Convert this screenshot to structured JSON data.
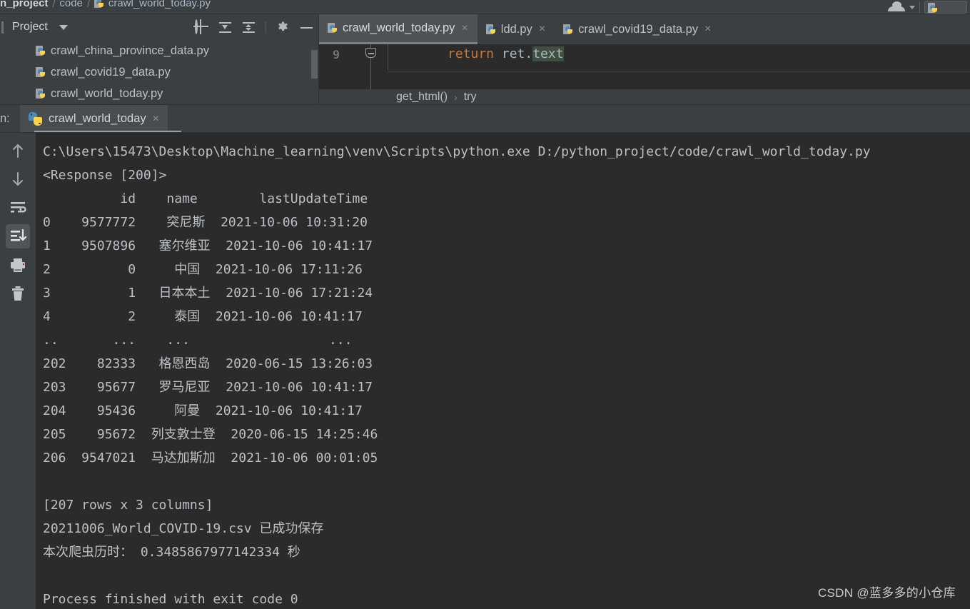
{
  "breadcrumb": {
    "project": "n_project",
    "sep": "/",
    "folder": "code",
    "file": "crawl_world_today.py"
  },
  "project_panel": {
    "title": "Project",
    "title_caret_icon": "chevron-down-icon",
    "tools": [
      {
        "name": "locate-icon",
        "label": "Select Opened File"
      },
      {
        "name": "expand-all-icon",
        "label": "Expand All"
      },
      {
        "name": "collapse-all-icon",
        "label": "Collapse All"
      },
      {
        "name": "gear-icon",
        "label": "Settings"
      },
      {
        "name": "minimize-icon",
        "label": "Hide"
      }
    ],
    "tree": [
      {
        "icon": "python-file-icon",
        "label": "crawl_china_province_data.py"
      },
      {
        "icon": "python-file-icon",
        "label": "crawl_covid19_data.py"
      },
      {
        "icon": "python-file-icon",
        "label": "crawl_world_today.py"
      }
    ]
  },
  "editor": {
    "tabs": [
      {
        "label": "crawl_world_today.py",
        "icon": "python-file-icon",
        "close": "×",
        "active": true
      },
      {
        "label": "ldd.py",
        "icon": "python-file-icon",
        "close": "×",
        "active": false
      },
      {
        "label": "crawl_covid19_data.py",
        "icon": "python-file-icon",
        "close": "×",
        "active": false
      }
    ],
    "line_number": "9",
    "code": {
      "keyword": "return",
      "expr_obj": " ret.",
      "expr_attr": "text"
    },
    "navbar": {
      "function": "get_html()",
      "sep": "›",
      "block": "try"
    }
  },
  "run_panel": {
    "label": "n:",
    "tab_label": "crawl_world_today",
    "tab_close": "×",
    "tab_icon": "python-logo-icon",
    "sidebar": [
      {
        "name": "up-arrow-icon",
        "label": "Previous Occurrence",
        "selected": false
      },
      {
        "name": "down-arrow-icon",
        "label": "Next Occurrence",
        "selected": false
      },
      {
        "name": "soft-wrap-icon",
        "label": "Soft-Wrap",
        "selected": false
      },
      {
        "name": "scroll-to-end-icon",
        "label": "Scroll to End",
        "selected": true
      },
      {
        "name": "printer-icon",
        "label": "Print",
        "selected": false
      },
      {
        "name": "trash-icon",
        "label": "Clear All",
        "selected": false
      }
    ]
  },
  "console": {
    "lines": [
      "C:\\Users\\15473\\Desktop\\Machine_learning\\venv\\Scripts\\python.exe D:/python_project/code/crawl_world_today.py",
      "<Response [200]>",
      "          id    name        lastUpdateTime",
      "0    9577772    突尼斯  2021-10-06 10:31:20",
      "1    9507896   塞尔维亚  2021-10-06 10:41:17",
      "2          0     中国  2021-10-06 17:11:26",
      "3          1   日本本土  2021-10-06 17:21:24",
      "4          2     泰国  2021-10-06 10:41:17",
      "..       ...    ...                  ...",
      "202    82333   格恩西岛  2020-06-15 13:26:03",
      "203    95677   罗马尼亚  2021-10-06 10:41:17",
      "204    95436     阿曼  2021-10-06 10:41:17",
      "205    95672  列支敦士登  2020-06-15 14:25:46",
      "206  9547021  马达加斯加  2021-10-06 00:01:05",
      "",
      "[207 rows x 3 columns]",
      "20211006_World_COVID-19.csv 已成功保存",
      "本次爬虫历时： 0.3485867977142334 秒",
      "",
      "Process finished with exit code 0"
    ]
  },
  "watermark": {
    "text": "CSDN @蓝多多的小仓库"
  },
  "colors": {
    "panel_bg": "#3c3f41",
    "console_bg": "#2b2b2b",
    "text": "#bcc0c4",
    "keyword_orange": "#cc7832",
    "highlight_green": "#3f5040",
    "python_blue": "#4b8bbe",
    "python_yellow": "#ffd343"
  }
}
